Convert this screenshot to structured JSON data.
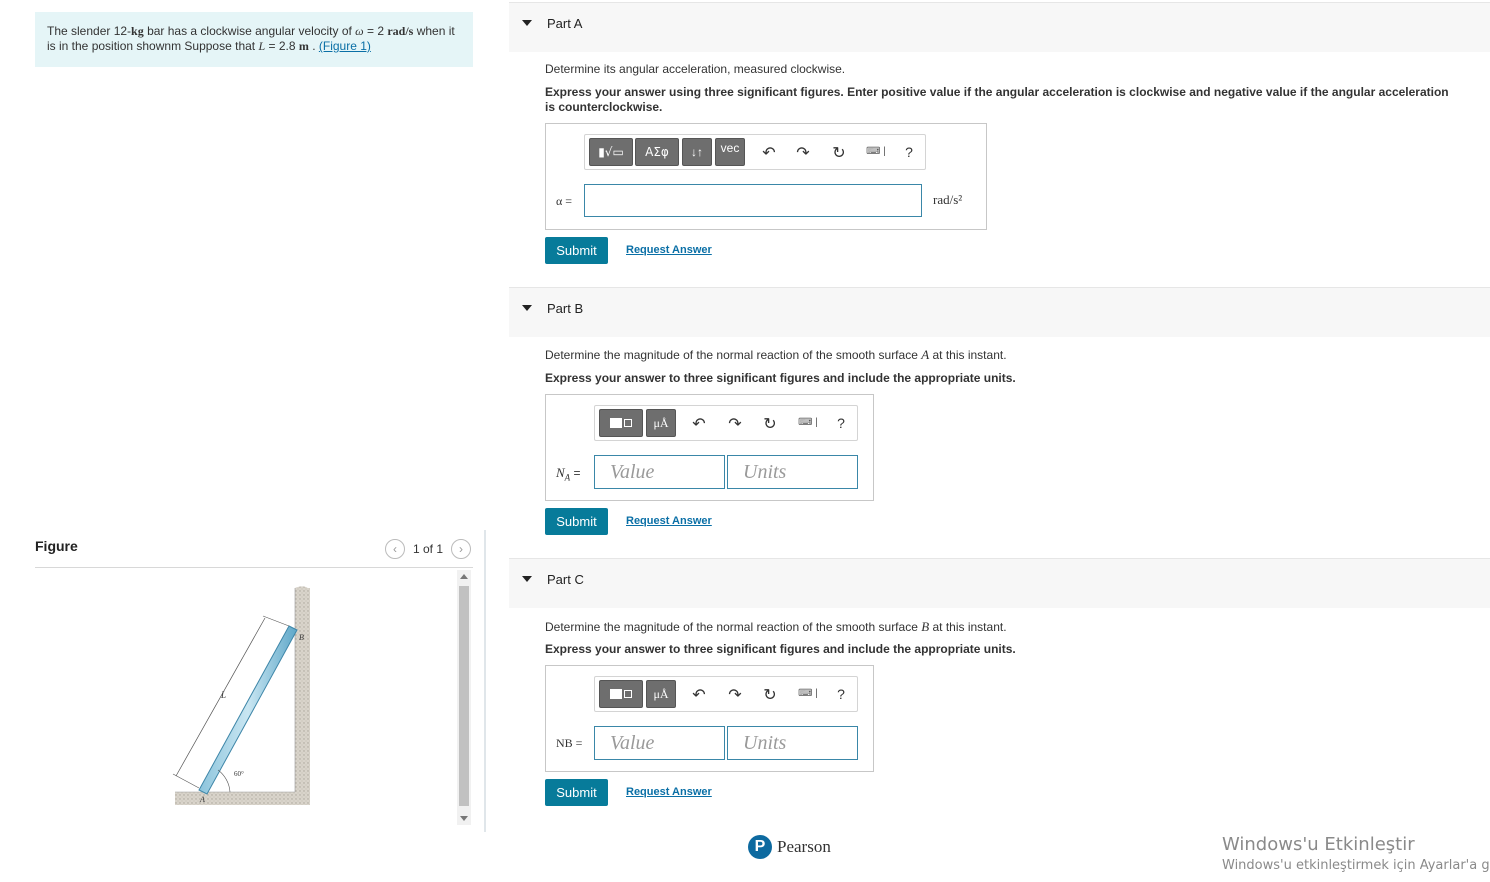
{
  "problem": {
    "t1": "The slender 12-",
    "kg": "kg",
    "t2": " bar has a clockwise angular velocity of ",
    "omega": "ω",
    "t3": " = 2 ",
    "rads": "rad/s",
    "t4": " when it is in the position shownm Suppose that ",
    "L": "L",
    "t5": " = 2.8 ",
    "m": "m",
    "t6": " . ",
    "figure_link": "(Figure 1)"
  },
  "figure": {
    "title": "Figure",
    "pager_text": "1 of 1",
    "labels": {
      "B": "B",
      "L": "L",
      "angle": "60°",
      "A": "A"
    }
  },
  "partA": {
    "title": "Part A",
    "question": "Determine its angular acceleration, measured clockwise.",
    "instruction": "Express your answer using three significant figures. Enter positive value if the angular acceleration is clockwise and negative value if the angular acceleration is counterclockwise.",
    "toolbar": {
      "templates": "▮√▭",
      "greek": "ΑΣφ",
      "arrows": "↓↑",
      "vec": "vec",
      "help": "?"
    },
    "var_label": "α =",
    "unit": "rad/s²",
    "submit": "Submit",
    "request": "Request Answer"
  },
  "partB": {
    "title": "Part B",
    "q1": "Determine the magnitude of the normal reaction of the smooth surface ",
    "q_var": "A",
    "q2": " at this instant.",
    "instruction": "Express your answer to three significant figures and include the appropriate units.",
    "toolbar": {
      "units": "μÅ",
      "help": "?"
    },
    "var_label": "N",
    "var_sub": "A",
    "var_eq": " =",
    "value_placeholder": "Value",
    "units_placeholder": "Units",
    "submit": "Submit",
    "request": "Request Answer"
  },
  "partC": {
    "title": "Part C",
    "q1": "Determine the magnitude of the normal reaction of the smooth surface ",
    "q_var": "B",
    "q2": " at this instant.",
    "instruction": "Express your answer to three significant figures and include the appropriate units.",
    "toolbar": {
      "units": "μÅ",
      "help": "?"
    },
    "var_label": "NB =",
    "value_placeholder": "Value",
    "units_placeholder": "Units",
    "submit": "Submit",
    "request": "Request Answer"
  },
  "footer": {
    "logo_letter": "P",
    "brand": "Pearson"
  },
  "windows": {
    "line1": "Windows'u Etkinleştir",
    "line2": "Windows'u etkinleştirmek için Ayarlar'a g"
  }
}
